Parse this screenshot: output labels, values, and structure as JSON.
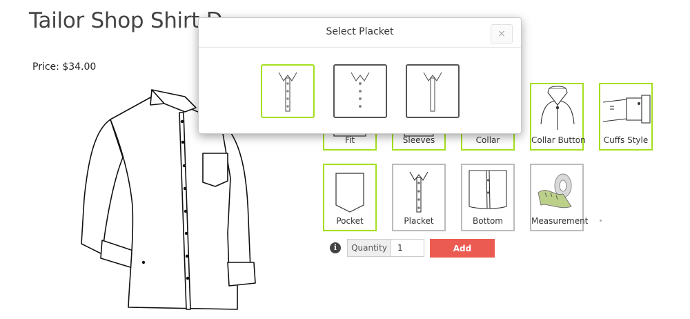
{
  "page": {
    "title": "Tailor Shop Shirt D",
    "price": "Price: $34.00"
  },
  "options": [
    {
      "label": "Fit",
      "icon": "fit-icon"
    },
    {
      "label": "Sleeves",
      "icon": "sleeves-icon"
    },
    {
      "label": "Collar",
      "icon": "collar-icon"
    },
    {
      "label": "Collar Button",
      "icon": "collar-button-icon"
    },
    {
      "label": "Cuffs Style",
      "icon": "cuff-icon"
    },
    {
      "label": "Pocket",
      "icon": "pocket-icon"
    },
    {
      "label": "Placket",
      "icon": "placket-icon"
    },
    {
      "label": "Bottom",
      "icon": "bottom-icon"
    },
    {
      "label": "Measurement",
      "icon": "measuring-tape-icon"
    }
  ],
  "order": {
    "quantity_label": "Quantity",
    "quantity_value": "1",
    "add_label": "Add"
  },
  "modal": {
    "title": "Select Placket",
    "close_label": "×"
  },
  "colors": {
    "selected_border": "#a4e01e",
    "add_button": "#ec5b52"
  }
}
